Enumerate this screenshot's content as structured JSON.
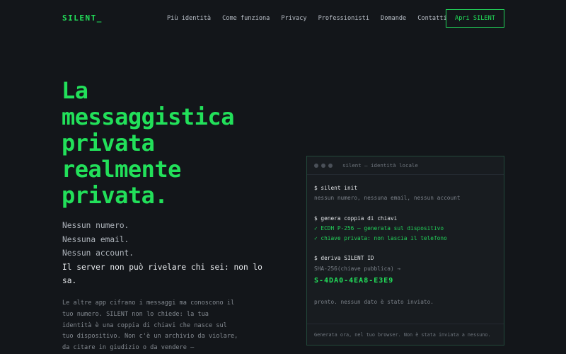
{
  "brand": {
    "logo": "SILENT_",
    "accent": "#22e05a"
  },
  "nav": {
    "links": [
      "Più identità",
      "Come funziona",
      "Privacy",
      "Professionisti",
      "Domande",
      "Contatti"
    ],
    "cta_label": "Apri SILENT"
  },
  "hero": {
    "title_lines": [
      "La",
      "messaggistica",
      "privata",
      "realmente",
      "privata."
    ],
    "subtitle_lines": [
      "Nessun numero.",
      "Nessuna email.",
      "Nessun account."
    ],
    "subtitle_strong": "Il server non può rivelare chi sei: non lo sa.",
    "body": "Le altre app cifrano i messaggi ma conoscono il tuo numero. SILENT non lo chiede: la tua identità è una coppia di chiavi che nasce sul tuo dispositivo. Non c'è un archivio da violare, da citare in giudizio o da vendere —"
  },
  "terminal": {
    "title": "silent — identità locale",
    "lines": [
      {
        "text": "$ silent init",
        "kind": "cmd"
      },
      {
        "text": "nessun numero, nessuna email, nessun account",
        "kind": "dim"
      },
      {
        "text": "",
        "kind": "gap"
      },
      {
        "text": "$ genera coppia di chiavi",
        "kind": "cmd"
      },
      {
        "text": "✓ ECDH P-256 — generata sul dispositivo",
        "kind": "ok"
      },
      {
        "text": "✓ chiave privata: non lascia il telefono",
        "kind": "ok"
      },
      {
        "text": "",
        "kind": "gap"
      },
      {
        "text": "$ deriva SILENT ID",
        "kind": "cmd"
      },
      {
        "text": "SHA-256(chiave pubblica) →",
        "kind": "dim"
      }
    ],
    "silent_id": "S-4DA0-4EA8-E3E9",
    "status": "pronto. nessun dato è stato inviato.",
    "footer": "Generata ora, nel tuo browser. Non è stata inviata a nessuno."
  }
}
